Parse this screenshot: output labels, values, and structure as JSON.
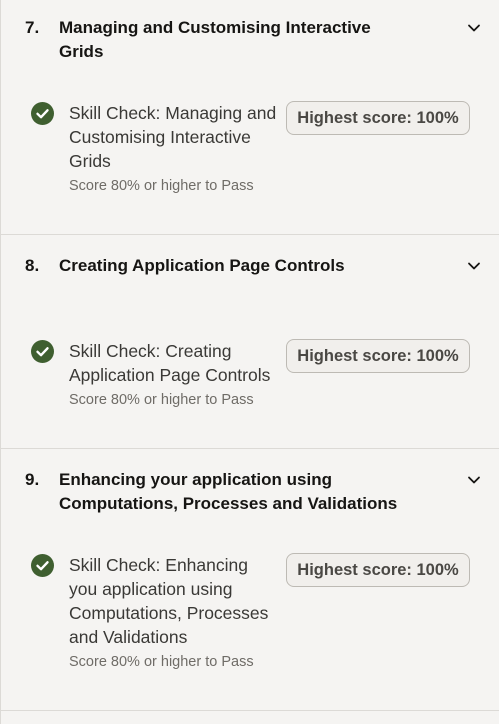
{
  "sections": [
    {
      "number": "7.",
      "title": "Managing and Customising Interactive Grids",
      "icon": "chevron-down-icon",
      "skill_check": {
        "status_icon": "check-circle-icon",
        "title": "Skill Check: Managing and Customising Interactive Grids",
        "pass_text": "Score 80% or higher to Pass",
        "score_label": "Highest score: 100%"
      }
    },
    {
      "number": "8.",
      "title": "Creating Application Page Controls",
      "icon": "chevron-down-icon",
      "skill_check": {
        "status_icon": "check-circle-icon",
        "title": "Skill Check: Creating Application Page Controls",
        "pass_text": "Score 80% or higher to Pass",
        "score_label": "Highest score: 100%"
      }
    },
    {
      "number": "9.",
      "title": "Enhancing your application using Computations, Processes and Validations",
      "icon": "chevron-down-icon",
      "skill_check": {
        "status_icon": "check-circle-icon",
        "title": "Skill Check: Enhancing you application using Computations, Processes and Validations",
        "pass_text": "Score 80% or higher to Pass",
        "score_label": "Highest score: 100%"
      }
    }
  ],
  "colors": {
    "success": "#3f5f30",
    "divider": "#dcdad6",
    "background": "#f5f4f2"
  }
}
